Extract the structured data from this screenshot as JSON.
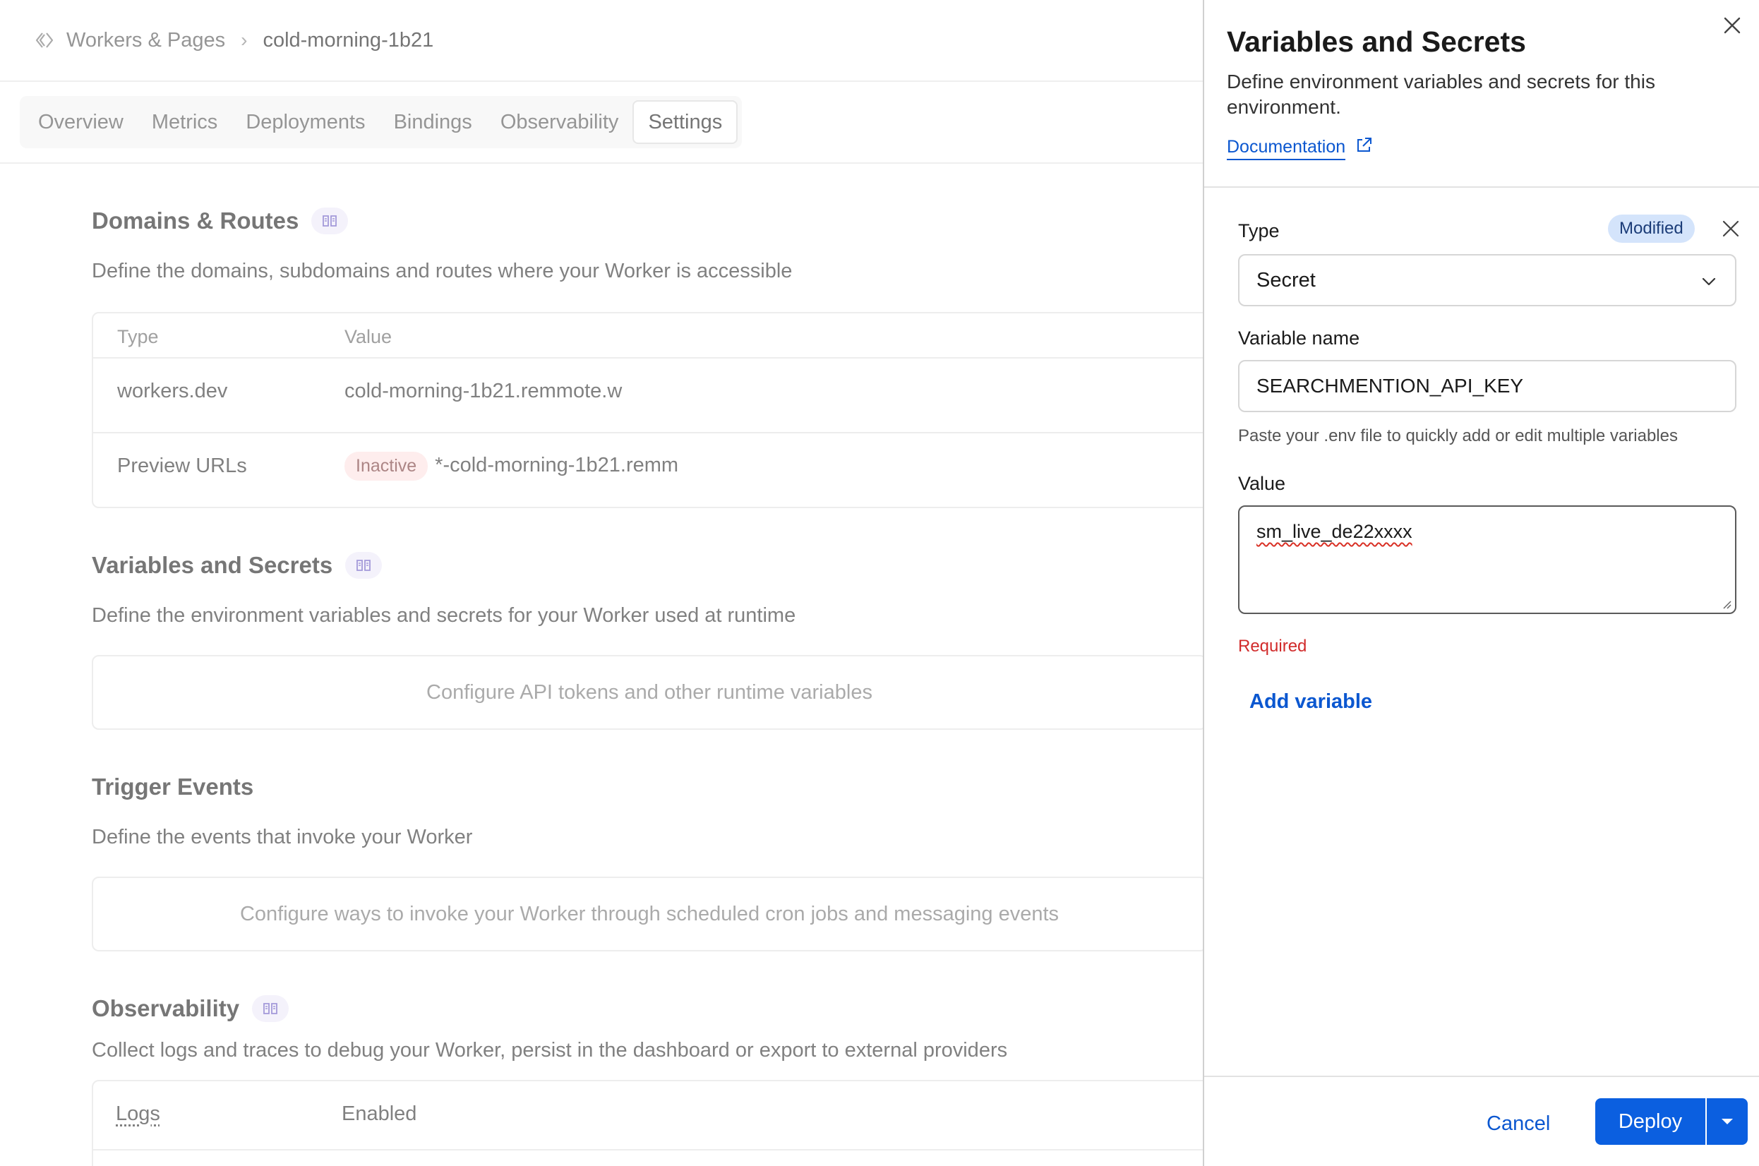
{
  "breadcrumb": {
    "root_label": "Workers & Pages",
    "current": "cold-morning-1b21"
  },
  "tabs": [
    {
      "label": "Overview"
    },
    {
      "label": "Metrics"
    },
    {
      "label": "Deployments"
    },
    {
      "label": "Bindings"
    },
    {
      "label": "Observability"
    },
    {
      "label": "Settings"
    }
  ],
  "domains": {
    "title": "Domains & Routes",
    "description": "Define the domains, subdomains and routes where your Worker is accessible",
    "col_type": "Type",
    "col_value": "Value",
    "rows": [
      {
        "type": "workers.dev",
        "value": "cold-morning-1b21.remmote.w"
      },
      {
        "type": "Preview URLs",
        "badge": "Inactive",
        "value": "*-cold-morning-1b21.remm"
      }
    ]
  },
  "variables": {
    "title": "Variables and Secrets",
    "description": "Define the environment variables and secrets for your Worker used at runtime",
    "placeholder": "Configure API tokens and other runtime variables"
  },
  "triggers": {
    "title": "Trigger Events",
    "description": "Define the events that invoke your Worker",
    "placeholder": "Configure ways to invoke your Worker through scheduled cron jobs and messaging events"
  },
  "observability": {
    "title": "Observability",
    "description": "Collect logs and traces to debug your Worker, persist in the dashboard or export to external providers",
    "logs_label": "Logs",
    "logs_value": "Enabled"
  },
  "drawer": {
    "title": "Variables and Secrets",
    "description": "Define environment variables and secrets for this environment.",
    "doc_link": "Documentation",
    "type_label": "Type",
    "modified_badge": "Modified",
    "type_value": "Secret",
    "name_label": "Variable name",
    "name_value": "SEARCHMENTION_API_KEY",
    "hint": "Paste your .env file to quickly add or edit multiple variables",
    "value_label": "Value",
    "value_text": "sm_live_de22xxxx",
    "required_text": "Required",
    "add_variable": "Add variable",
    "cancel": "Cancel",
    "deploy": "Deploy"
  },
  "colors": {
    "accent": "#0b5fe0",
    "link": "#0b57d0",
    "error": "#d12b2b",
    "modified_bg": "#d4e4fb",
    "inactive_bg": "#fde2e2"
  },
  "icons": [
    "workers-icon",
    "chevron-right-icon",
    "docs-icon",
    "close-icon",
    "external-link-icon",
    "chevron-down-icon",
    "caret-down-icon"
  ]
}
